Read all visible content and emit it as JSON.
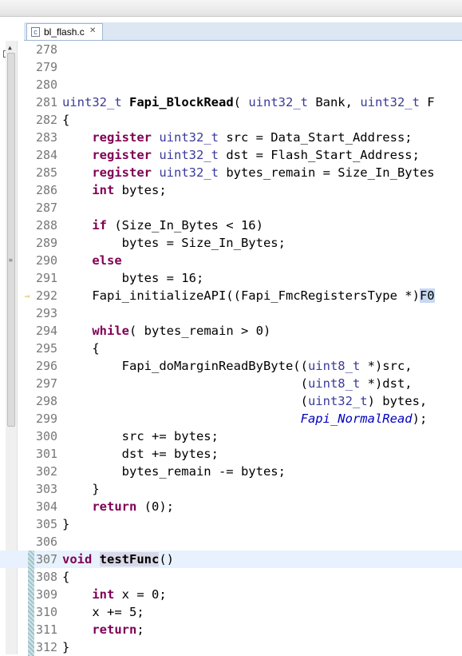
{
  "tab": {
    "filename": "bl_flash.c",
    "close": "✕"
  },
  "lines": [
    {
      "n": "278",
      "code": ""
    },
    {
      "n": "279",
      "code": ""
    },
    {
      "n": "280",
      "code": ""
    },
    {
      "n": "281",
      "code": "uint32_t Fapi_BlockRead( uint32_t Bank, uint32_t F"
    },
    {
      "n": "282",
      "code": "{"
    },
    {
      "n": "283",
      "code": "    register uint32_t src = Data_Start_Address;"
    },
    {
      "n": "284",
      "code": "    register uint32_t dst = Flash_Start_Address;"
    },
    {
      "n": "285",
      "code": "    register uint32_t bytes_remain = Size_In_Bytes"
    },
    {
      "n": "286",
      "code": "    int bytes;"
    },
    {
      "n": "287",
      "code": ""
    },
    {
      "n": "288",
      "code": "    if (Size_In_Bytes < 16)"
    },
    {
      "n": "289",
      "code": "        bytes = Size_In_Bytes;"
    },
    {
      "n": "290",
      "code": "    else"
    },
    {
      "n": "291",
      "code": "        bytes = 16;"
    },
    {
      "n": "292",
      "code": "    Fapi_initializeAPI((Fapi_FmcRegistersType *)F0"
    },
    {
      "n": "293",
      "code": ""
    },
    {
      "n": "294",
      "code": "    while( bytes_remain > 0)"
    },
    {
      "n": "295",
      "code": "    {"
    },
    {
      "n": "296",
      "code": "        Fapi_doMarginReadByByte((uint8_t *)src,"
    },
    {
      "n": "297",
      "code": "                                (uint8_t *)dst,"
    },
    {
      "n": "298",
      "code": "                                (uint32_t) bytes,"
    },
    {
      "n": "299",
      "code": "                                Fapi_NormalRead);"
    },
    {
      "n": "300",
      "code": "        src += bytes;"
    },
    {
      "n": "301",
      "code": "        dst += bytes;"
    },
    {
      "n": "302",
      "code": "        bytes_remain -= bytes;"
    },
    {
      "n": "303",
      "code": "    }"
    },
    {
      "n": "304",
      "code": "    return (0);"
    },
    {
      "n": "305",
      "code": "}"
    },
    {
      "n": "306",
      "code": ""
    },
    {
      "n": "307",
      "code": "void testFunc()"
    },
    {
      "n": "308",
      "code": "{"
    },
    {
      "n": "309",
      "code": "    int x = 0;"
    },
    {
      "n": "310",
      "code": "    x += 5;"
    },
    {
      "n": "311",
      "code": "    return;"
    },
    {
      "n": "312",
      "code": "}"
    }
  ],
  "current_line": "292",
  "cursor_line": "307",
  "changed_lines": [
    "307",
    "308",
    "309",
    "310",
    "311",
    "312"
  ],
  "colors": {
    "keyword": "#7f0055",
    "italic_enum": "#0000c0",
    "line_number": "#787878",
    "tab_bg": "#dde7f3"
  }
}
